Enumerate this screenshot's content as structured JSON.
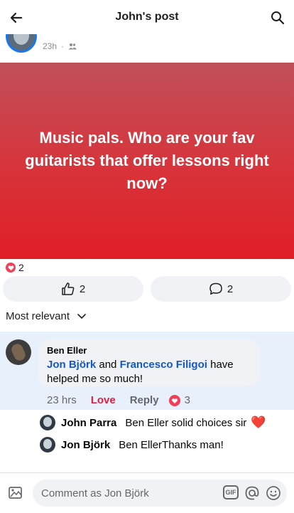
{
  "header": {
    "title": "John's post",
    "back_icon": "arrow-left-icon",
    "search_icon": "search-icon"
  },
  "post": {
    "time": "23h",
    "audience_icon": "friends-icon",
    "text": "Music pals. Who are your fav guitarists that offer lessons right now?",
    "reaction_count": "2"
  },
  "actions": {
    "like_count": "2",
    "comment_count": "2"
  },
  "sort": {
    "label": "Most relevant"
  },
  "comment": {
    "author": "Ben Eller",
    "mention1": "Jon Björk",
    "connector": " and ",
    "mention2": "Francesco Filigoi",
    "text_end": " have helped me so much!",
    "time": "23 hrs",
    "love_label": "Love",
    "reply_label": "Reply",
    "reaction_count": "3"
  },
  "replies": [
    {
      "author": "John Parra",
      "text": "Ben Eller solid choices sir",
      "emoji": "❤️"
    },
    {
      "author": "Jon Björk",
      "text": "Ben EllerThanks man!"
    }
  ],
  "composer": {
    "placeholder": "Comment as Jon Björk",
    "gif_label": "GIF"
  },
  "colors": {
    "accent": "#1877f2",
    "love": "#e41e3f",
    "banner_top": "#c0505a",
    "banner_bottom": "#e01e26",
    "highlight": "#e8f0fc"
  }
}
